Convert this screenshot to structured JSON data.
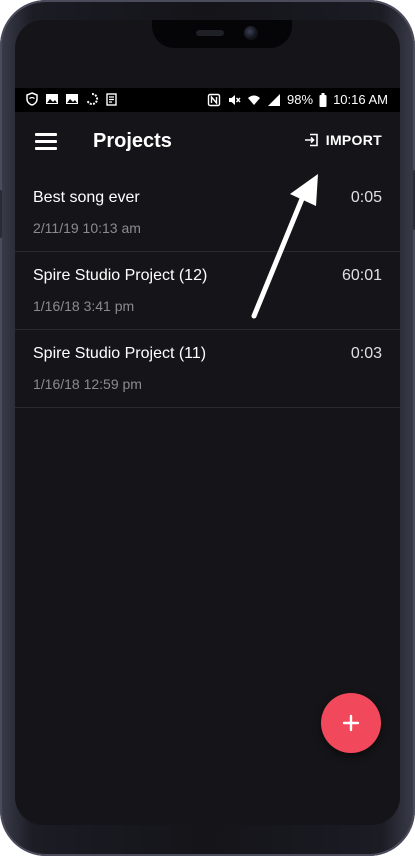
{
  "status_bar": {
    "battery_percent": "98%",
    "time": "10:16 AM",
    "left_icons": [
      "shield-icon",
      "image-icon",
      "image-icon",
      "sync-icon",
      "clipboard-icon"
    ],
    "right_icons": [
      "nfc-icon",
      "mute-icon",
      "wifi-icon",
      "signal-icon",
      "battery-icon"
    ]
  },
  "app_bar": {
    "title": "Projects",
    "import_label": "IMPORT"
  },
  "projects": [
    {
      "title": "Best song ever",
      "date": "2/11/19 10:13 am",
      "duration": "0:05"
    },
    {
      "title": "Spire Studio Project (12)",
      "date": "1/16/18 3:41 pm",
      "duration": "60:01"
    },
    {
      "title": "Spire Studio Project (11)",
      "date": "1/16/18 12:59 pm",
      "duration": "0:03"
    }
  ],
  "colors": {
    "background": "#151519",
    "accent": "#f2485b",
    "text_secondary": "#8a8a90"
  }
}
